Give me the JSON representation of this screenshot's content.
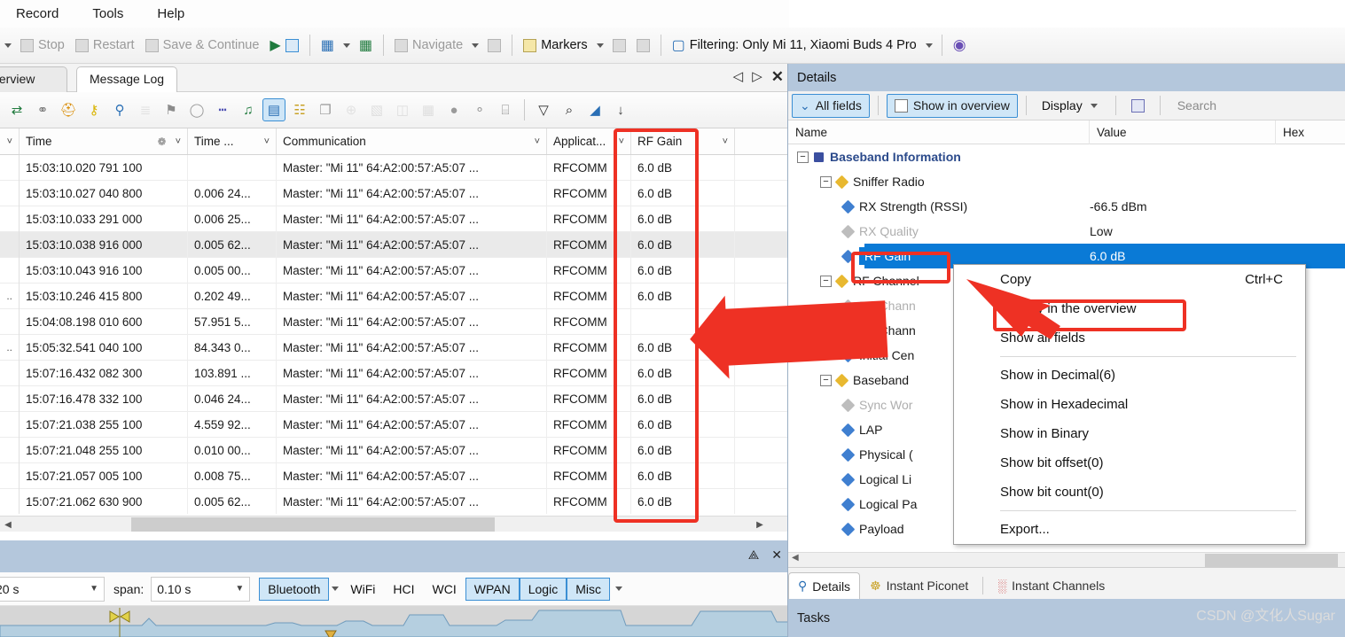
{
  "menu": {
    "items": [
      "Record",
      "Tools",
      "Help"
    ]
  },
  "toolbar": {
    "stop": "Stop",
    "restart": "Restart",
    "save_continue": "Save & Continue",
    "navigate": "Navigate",
    "markers": "Markers",
    "filtering": "Filtering: Only Mi 11, Xiaomi Buds 4 Pro"
  },
  "left_pane": {
    "tabs": [
      {
        "label": "Overview",
        "active": false
      },
      {
        "label": "Message Log",
        "active": true
      }
    ],
    "nav": {
      "prev": "◁",
      "next": "▷",
      "close": "✕"
    },
    "iconbar": [
      {
        "name": "arrow-swap-icon",
        "glyph": "⇄",
        "color": "#1f7a3d",
        "faded": false,
        "selected": false
      },
      {
        "name": "link-icon",
        "glyph": "⚭",
        "color": "#7a7a7a",
        "faded": false,
        "selected": false
      },
      {
        "name": "bell-icon",
        "glyph": "⛑",
        "color": "#d98b00",
        "faded": false,
        "selected": false
      },
      {
        "name": "key-icon",
        "glyph": "⚷",
        "color": "#d9b300",
        "faded": false,
        "selected": false
      },
      {
        "name": "magnifier-icon",
        "glyph": "⚲",
        "color": "#2a6fb5",
        "faded": false,
        "selected": false
      },
      {
        "name": "list-icon",
        "glyph": "≣",
        "color": "#b9b9b9",
        "faded": true,
        "selected": false
      },
      {
        "name": "checkered-flag-icon",
        "glyph": "⚑",
        "color": "#8c8c8c",
        "faded": false,
        "selected": false
      },
      {
        "name": "mouse-icon",
        "glyph": "◯",
        "color": "#9a9a9a",
        "faded": false,
        "selected": false
      },
      {
        "name": "waveform-icon",
        "glyph": "┅",
        "color": "#5153b5",
        "faded": false,
        "selected": false
      },
      {
        "name": "music-note-icon",
        "glyph": "♫",
        "color": "#1f7a3d",
        "faded": false,
        "selected": false
      },
      {
        "name": "radio-icon",
        "glyph": "▤",
        "color": "#2a6fb5",
        "faded": false,
        "selected": true
      },
      {
        "name": "books-icon",
        "glyph": "☷",
        "color": "#c9a227",
        "faded": false,
        "selected": false
      },
      {
        "name": "copy-icon",
        "glyph": "❐",
        "color": "#9a9a9a",
        "faded": false,
        "selected": false
      },
      {
        "name": "globe-grid-icon",
        "glyph": "⊕",
        "color": "#bdbdbd",
        "faded": true,
        "selected": false
      },
      {
        "name": "page-icon",
        "glyph": "▧",
        "color": "#b3b3b3",
        "faded": true,
        "selected": false
      },
      {
        "name": "book-open-icon",
        "glyph": "◫",
        "color": "#b3b3b3",
        "faded": true,
        "selected": false
      },
      {
        "name": "grid-icon",
        "glyph": "▦",
        "color": "#b3b3b3",
        "faded": true,
        "selected": false
      },
      {
        "name": "globe-icon",
        "glyph": "●",
        "color": "#9a9a9a",
        "faded": false,
        "selected": false
      },
      {
        "name": "network-icon",
        "glyph": "⚬",
        "color": "#9a9a9a",
        "faded": false,
        "selected": false
      },
      {
        "name": "binary-icon",
        "glyph": "⌸",
        "color": "#8c8c8c",
        "faded": false,
        "selected": false
      },
      {
        "name": "funnel-icon",
        "glyph": "▽",
        "color": "#2b2b2b",
        "faded": false,
        "selected": false
      },
      {
        "name": "search-icon",
        "glyph": "⌕",
        "color": "#1a1a1a",
        "faded": false,
        "selected": false
      },
      {
        "name": "paint-bucket-icon",
        "glyph": "◢",
        "color": "#2a6fb5",
        "faded": false,
        "selected": false
      },
      {
        "name": "antenna-down-icon",
        "glyph": "↓",
        "color": "#3a3a3a",
        "faded": false,
        "selected": false
      }
    ],
    "table": {
      "columns": [
        {
          "key": "idx",
          "label": ""
        },
        {
          "key": "time",
          "label": "Time"
        },
        {
          "key": "delta",
          "label": "Time ..."
        },
        {
          "key": "comm",
          "label": "Communication"
        },
        {
          "key": "app",
          "label": "Applicat..."
        },
        {
          "key": "rf",
          "label": "RF Gain"
        }
      ],
      "rows": [
        {
          "idx": "",
          "time": "15:03:10.020 791 100",
          "delta": "",
          "comm": "Master: \"Mi 11\" 64:A2:00:57:A5:07 ...",
          "app": "RFCOMM",
          "rf": "6.0 dB",
          "highlight": false
        },
        {
          "idx": "",
          "time": "15:03:10.027 040 800",
          "delta": "0.006 24...",
          "comm": "Master: \"Mi 11\" 64:A2:00:57:A5:07 ...",
          "app": "RFCOMM",
          "rf": "6.0 dB",
          "highlight": false
        },
        {
          "idx": "",
          "time": "15:03:10.033 291 000",
          "delta": "0.006 25...",
          "comm": "Master: \"Mi 11\" 64:A2:00:57:A5:07 ...",
          "app": "RFCOMM",
          "rf": "6.0 dB",
          "highlight": false
        },
        {
          "idx": "",
          "time": "15:03:10.038 916 000",
          "delta": "0.005 62...",
          "comm": "Master: \"Mi 11\" 64:A2:00:57:A5:07 ...",
          "app": "RFCOMM",
          "rf": "6.0 dB",
          "highlight": true
        },
        {
          "idx": "",
          "time": "15:03:10.043 916 100",
          "delta": "0.005 00...",
          "comm": "Master: \"Mi 11\" 64:A2:00:57:A5:07 ...",
          "app": "RFCOMM",
          "rf": "6.0 dB",
          "highlight": false
        },
        {
          "idx": "..",
          "time": "15:03:10.246 415 800",
          "delta": "0.202 49...",
          "comm": "Master: \"Mi 11\" 64:A2:00:57:A5:07 ...",
          "app": "RFCOMM",
          "rf": "6.0 dB",
          "highlight": false
        },
        {
          "idx": "",
          "time": "15:04:08.198 010 600",
          "delta": "57.951 5...",
          "comm": "Master: \"Mi 11\" 64:A2:00:57:A5:07 ...",
          "app": "RFCOMM",
          "rf": "",
          "highlight": false
        },
        {
          "idx": "..",
          "time": "15:05:32.541 040 100",
          "delta": "84.343 0...",
          "comm": "Master: \"Mi 11\" 64:A2:00:57:A5:07 ...",
          "app": "RFCOMM",
          "rf": "6.0 dB",
          "highlight": false
        },
        {
          "idx": "",
          "time": "15:07:16.432 082 300",
          "delta": "103.891 ...",
          "comm": "Master: \"Mi 11\" 64:A2:00:57:A5:07 ...",
          "app": "RFCOMM",
          "rf": "6.0 dB",
          "highlight": false
        },
        {
          "idx": "",
          "time": "15:07:16.478 332 100",
          "delta": "0.046 24...",
          "comm": "Master: \"Mi 11\" 64:A2:00:57:A5:07 ...",
          "app": "RFCOMM",
          "rf": "6.0 dB",
          "highlight": false
        },
        {
          "idx": "",
          "time": "15:07:21.038 255 100",
          "delta": "4.559 92...",
          "comm": "Master: \"Mi 11\" 64:A2:00:57:A5:07 ...",
          "app": "RFCOMM",
          "rf": "6.0 dB",
          "highlight": false
        },
        {
          "idx": "",
          "time": "15:07:21.048 255 100",
          "delta": "0.010 00...",
          "comm": "Master: \"Mi 11\" 64:A2:00:57:A5:07 ...",
          "app": "RFCOMM",
          "rf": "6.0 dB",
          "highlight": false
        },
        {
          "idx": "",
          "time": "15:07:21.057 005 100",
          "delta": "0.008 75...",
          "comm": "Master: \"Mi 11\" 64:A2:00:57:A5:07 ...",
          "app": "RFCOMM",
          "rf": "6.0 dB",
          "highlight": false
        },
        {
          "idx": "",
          "time": "15:07:21.062 630 900",
          "delta": "0.005 62...",
          "comm": "Master: \"Mi 11\" 64:A2:00:57:A5:07 ...",
          "app": "RFCOMM",
          "rf": "6.0 dB",
          "highlight": false
        }
      ]
    }
  },
  "timeline": {
    "range_value": "20 s",
    "span_label": "span:",
    "span_value": "0.10 s",
    "protocols": [
      {
        "label": "Bluetooth",
        "on": true
      },
      {
        "label": "WiFi",
        "on": false
      },
      {
        "label": "HCI",
        "on": false
      },
      {
        "label": "WCI",
        "on": false
      },
      {
        "label": "WPAN",
        "on": true
      },
      {
        "label": "Logic",
        "on": true
      },
      {
        "label": "Misc",
        "on": true
      }
    ],
    "pin": "⟁",
    "close": "✕"
  },
  "details": {
    "title": "Details",
    "buttons": {
      "all_fields": "All fields",
      "show_in_overview": "Show in overview",
      "display": "Display",
      "search_placeholder": "Search"
    },
    "columns": {
      "name": "Name",
      "value": "Value",
      "hex": "Hex"
    },
    "tree": [
      {
        "label": "Baseband Information",
        "value": "",
        "depth": 0,
        "kind": "group-blue",
        "expander": "−"
      },
      {
        "label": "Sniffer Radio",
        "value": "",
        "depth": 1,
        "kind": "group-gold",
        "expander": "−"
      },
      {
        "label": "RX Strength (RSSI)",
        "value": "-66.5 dBm",
        "depth": 2,
        "kind": "leaf",
        "expander": ""
      },
      {
        "label": "RX Quality",
        "value": "Low",
        "depth": 2,
        "kind": "leaf-fade",
        "expander": ""
      },
      {
        "label": "RF Gain",
        "value": "6.0 dB",
        "depth": 2,
        "kind": "leaf-selected",
        "expander": ""
      },
      {
        "label": "RF Channel",
        "value": "",
        "depth": 1,
        "kind": "group-gold",
        "expander": "−"
      },
      {
        "label": "RF Chann",
        "value": "",
        "depth": 2,
        "kind": "leaf-fade",
        "expander": ""
      },
      {
        "label": "RF Chann",
        "value": "",
        "depth": 2,
        "kind": "leaf",
        "expander": ""
      },
      {
        "label": "Initial Cen",
        "value": "",
        "depth": 2,
        "kind": "leaf",
        "expander": ""
      },
      {
        "label": "Baseband",
        "value": "",
        "depth": 1,
        "kind": "group-gold",
        "expander": "−"
      },
      {
        "label": "Sync Wor",
        "value": "",
        "depth": 2,
        "kind": "leaf-fade",
        "expander": ""
      },
      {
        "label": "LAP",
        "value": "",
        "depth": 2,
        "kind": "leaf",
        "expander": ""
      },
      {
        "label": "Physical (",
        "value": "",
        "depth": 2,
        "kind": "leaf",
        "expander": ""
      },
      {
        "label": "Logical Li",
        "value": "",
        "depth": 2,
        "kind": "leaf",
        "expander": ""
      },
      {
        "label": "Logical Pa",
        "value": "",
        "depth": 2,
        "kind": "leaf",
        "expander": ""
      },
      {
        "label": "Payload",
        "value": "",
        "depth": 2,
        "kind": "leaf",
        "expander": ""
      }
    ],
    "checkmark": "✓",
    "tabs": [
      {
        "label": "Details",
        "active": true,
        "icon": "details-icon"
      },
      {
        "label": "Instant Piconet",
        "active": false,
        "icon": "piconet-icon"
      },
      {
        "label": "Instant Channels",
        "active": false,
        "icon": "channels-icon"
      }
    ],
    "tasks_label": "Tasks"
  },
  "context_menu": {
    "items": [
      {
        "label": "Copy",
        "accel": "Ctrl+C",
        "sep_after": false
      },
      {
        "label": "Display in the overview",
        "accel": "",
        "sep_after": false
      },
      {
        "label": "Show all fields",
        "accel": "",
        "sep_after": true
      },
      {
        "label": "Show in Decimal(6)",
        "accel": "",
        "sep_after": false
      },
      {
        "label": "Show in Hexadecimal",
        "accel": "",
        "sep_after": false
      },
      {
        "label": "Show in Binary",
        "accel": "",
        "sep_after": false
      },
      {
        "label": "Show bit offset(0)",
        "accel": "",
        "sep_after": false
      },
      {
        "label": "Show bit count(0)",
        "accel": "",
        "sep_after": true
      },
      {
        "label": "Export...",
        "accel": "",
        "sep_after": false
      }
    ]
  },
  "watermark": "CSDN @文化人Sugar",
  "colors": {
    "annotation_red": "#ee3124",
    "selection_blue": "#0a7ad6",
    "accent_blue": "#3b8fd4",
    "panel_header": "#b4c7dc"
  }
}
